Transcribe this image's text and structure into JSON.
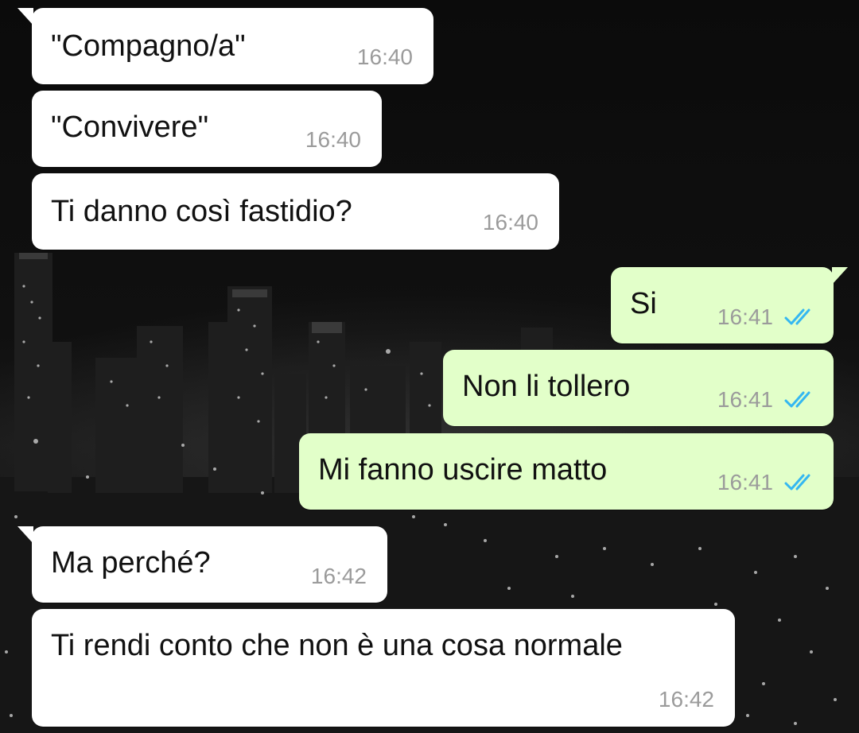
{
  "chat": {
    "accent_read_ticks": "#34b7f1",
    "incoming_bubble_color": "#ffffff",
    "outgoing_bubble_color": "#e2ffc9",
    "messages": [
      {
        "direction": "incoming",
        "text": "\"Compagno/a\"",
        "time": "16:40"
      },
      {
        "direction": "incoming",
        "text": "\"Convivere\"",
        "time": "16:40"
      },
      {
        "direction": "incoming",
        "text": "Ti danno così fastidio?",
        "time": "16:40"
      },
      {
        "direction": "outgoing",
        "text": "Si",
        "time": "16:41",
        "status_icon": "double-check-read-icon"
      },
      {
        "direction": "outgoing",
        "text": "Non li tollero",
        "time": "16:41",
        "status_icon": "double-check-read-icon"
      },
      {
        "direction": "outgoing",
        "text": "Mi fanno uscire matto",
        "time": "16:41",
        "status_icon": "double-check-read-icon"
      },
      {
        "direction": "incoming",
        "text": "Ma perché?",
        "time": "16:42"
      },
      {
        "direction": "incoming",
        "text": "Ti rendi conto che non è una cosa normale",
        "time": "16:42"
      }
    ]
  }
}
